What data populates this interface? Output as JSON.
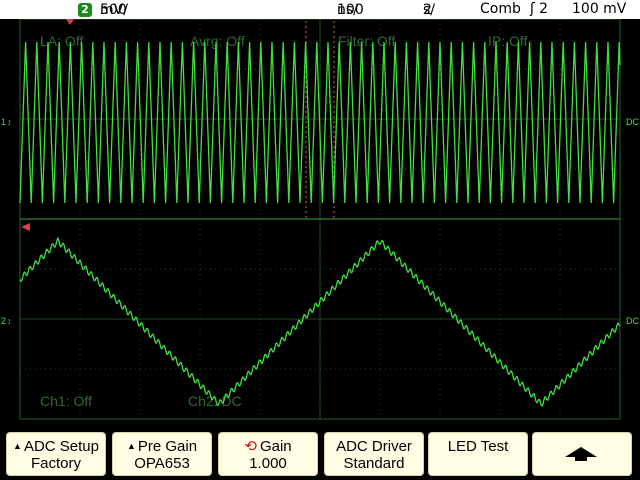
{
  "status_bar": {
    "channel_number": "2",
    "channel_scale": "500",
    "channel_units": "mV/",
    "timebase_value": "100",
    "timebase_units": "ns/",
    "sample_value": "2",
    "sample_units": "s/",
    "math_label": "Comb",
    "trigger_label": "ʃ 2",
    "trigger_level": "100 mV"
  },
  "overlay": {
    "la": "LA: Off",
    "avrg": "Avrg: Off",
    "filter": "Filter: Off",
    "ip": "IP: Off",
    "ch1": "Ch1: Off",
    "ch2": "Ch2: DC",
    "dc_top": "DC",
    "dc_bottom": "DC"
  },
  "softkeys": [
    {
      "line1": "ADC Setup",
      "line2": "Factory",
      "icon": "up-triangle-icon"
    },
    {
      "line1": "Pre Gain",
      "line2": "OPA653",
      "icon": "up-triangle-icon"
    },
    {
      "line1": "Gain",
      "line2": "1.000",
      "icon": "rotate-knob-icon"
    },
    {
      "line1": "ADC Driver",
      "line2": "Standard",
      "icon": ""
    },
    {
      "line1": "LED Test",
      "line2": "",
      "icon": ""
    },
    {
      "line1": "",
      "line2": "",
      "icon": "arrow-up-icon"
    }
  ],
  "colors": {
    "trace": "#3fe03f",
    "grid": "#2a5a2a",
    "overlay_text": "#2f6b2f",
    "softkey_bg": "#fffde4",
    "marker": "#e04040"
  }
}
